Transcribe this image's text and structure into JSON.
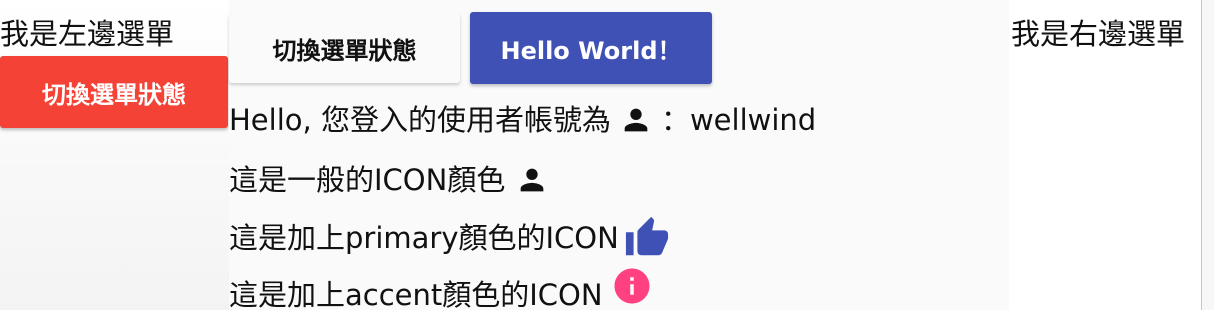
{
  "left_sidenav": {
    "title": "我是左邊選單",
    "toggle_button_label": "切換選單狀態",
    "toggle_button_color": "#f44336"
  },
  "toolbar": {
    "toggle_button_label": "切換選單狀態",
    "hello_button_label": "Hello World！",
    "hello_button_color": "#3f51b5"
  },
  "content": {
    "line1_prefix": "Hello, 您登入的使用者帳號為",
    "line1_icon": "person-icon",
    "line1_suffix": "：wellwind",
    "line2_text": "這是一般的ICON顏色",
    "line2_icon": "person-icon",
    "line3_text": "這是加上primary顏色的ICON",
    "line3_icon": "thumb-up-icon",
    "line3_icon_color": "#3f51b5",
    "line4_text": "這是加上accent顏色的ICON",
    "line4_icon": "info-icon",
    "line4_icon_color": "#ff4081"
  },
  "right_sidenav": {
    "title": "我是右邊選單"
  }
}
